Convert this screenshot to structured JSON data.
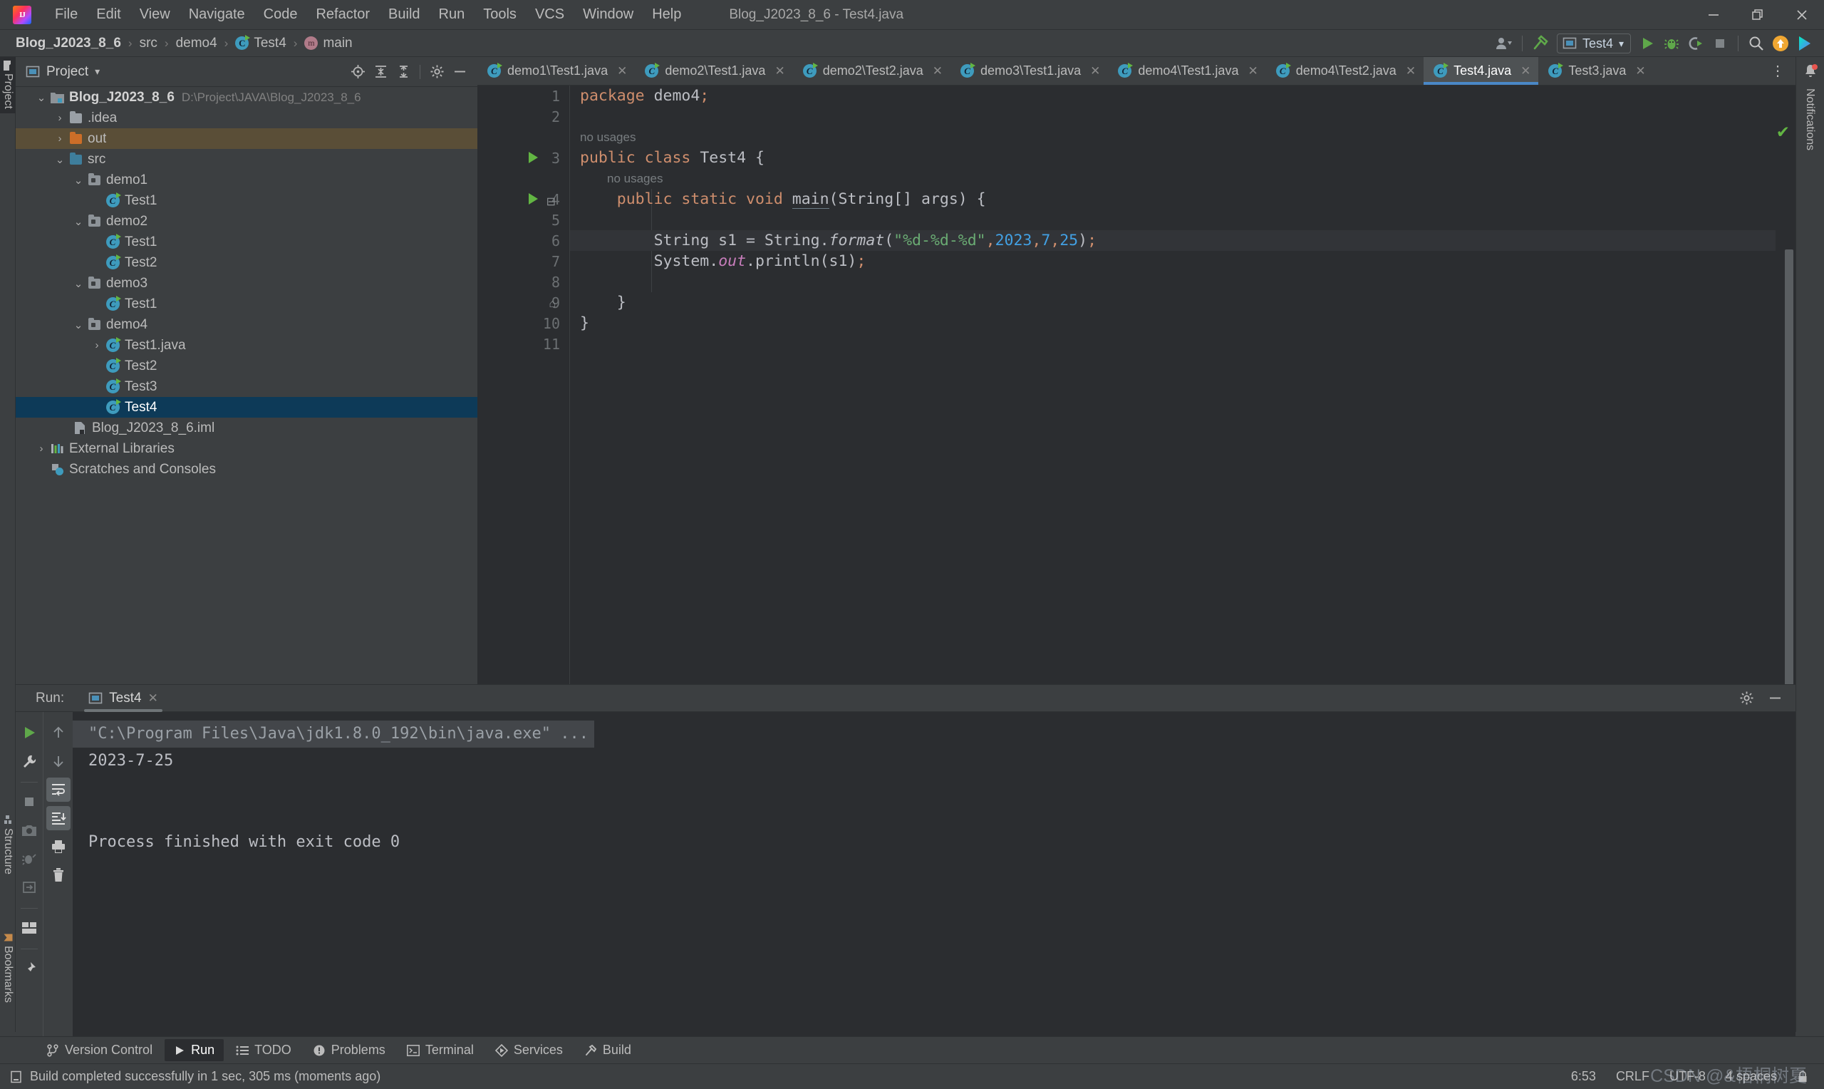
{
  "window": {
    "title": "Blog_J2023_8_6 - Test4.java",
    "minimize_label": "–",
    "restore_label": "❐",
    "close_label": "✕"
  },
  "menubar": {
    "items": [
      {
        "label": "File"
      },
      {
        "label": "Edit"
      },
      {
        "label": "View"
      },
      {
        "label": "Navigate"
      },
      {
        "label": "Code"
      },
      {
        "label": "Refactor"
      },
      {
        "label": "Build"
      },
      {
        "label": "Run"
      },
      {
        "label": "Tools"
      },
      {
        "label": "VCS"
      },
      {
        "label": "Window"
      },
      {
        "label": "Help"
      }
    ]
  },
  "navbar": {
    "crumbs": [
      {
        "label": "Blog_J2023_8_6",
        "icon": "project-icon"
      },
      {
        "label": "src",
        "icon": "none"
      },
      {
        "label": "demo4",
        "icon": "none"
      },
      {
        "label": "Test4",
        "icon": "java-class-icon"
      },
      {
        "label": "main",
        "icon": "method-icon"
      }
    ],
    "separator": "›",
    "run_config": "Test4",
    "run_config_caret": "▾",
    "icons": [
      "user-settings-icon",
      "build-hammer-icon",
      "run-icon",
      "debug-icon",
      "run-coverage-icon",
      "stop-icon",
      "search-everywhere-icon",
      "update-project-icon",
      "idea-assistant-icon"
    ]
  },
  "left_tool_strip": {
    "tabs": [
      {
        "label": "Project",
        "active": true
      },
      {
        "label": "Structure",
        "active": false
      },
      {
        "label": "Bookmarks",
        "active": false
      }
    ]
  },
  "right_tool_strip": {
    "label": "Notifications",
    "icon": "bell-icon",
    "has_badge": true
  },
  "project_panel": {
    "title": "Project",
    "title_caret": "▾",
    "toolbar_icons": [
      "locate-icon",
      "expand-all-icon",
      "collapse-all-icon",
      "settings-gear-icon",
      "hide-icon"
    ],
    "tree": [
      {
        "depth": 0,
        "arrow": "⌄",
        "icon": "project-module-icon",
        "label": "Blog_J2023_8_6",
        "sub": "D:\\Project\\JAVA\\Blog_J2023_8_6",
        "state": "bold"
      },
      {
        "depth": 1,
        "arrow": "›",
        "icon": "folder-grey-icon",
        "label": ".idea",
        "sub": "",
        "state": "normal"
      },
      {
        "depth": 1,
        "arrow": "›",
        "icon": "folder-orange-icon",
        "label": "out",
        "sub": "",
        "state": "highlight"
      },
      {
        "depth": 1,
        "arrow": "⌄",
        "icon": "folder-blue-icon",
        "label": "src",
        "sub": "",
        "state": "normal"
      },
      {
        "depth": 2,
        "arrow": "⌄",
        "icon": "package-icon",
        "label": "demo1",
        "sub": "",
        "state": "normal"
      },
      {
        "depth": 3,
        "arrow": "",
        "icon": "java-class-icon",
        "label": "Test1",
        "sub": "",
        "state": "normal"
      },
      {
        "depth": 2,
        "arrow": "⌄",
        "icon": "package-icon",
        "label": "demo2",
        "sub": "",
        "state": "normal"
      },
      {
        "depth": 3,
        "arrow": "",
        "icon": "java-class-icon",
        "label": "Test1",
        "sub": "",
        "state": "normal"
      },
      {
        "depth": 3,
        "arrow": "",
        "icon": "java-class-icon",
        "label": "Test2",
        "sub": "",
        "state": "normal"
      },
      {
        "depth": 2,
        "arrow": "⌄",
        "icon": "package-icon",
        "label": "demo3",
        "sub": "",
        "state": "normal"
      },
      {
        "depth": 3,
        "arrow": "",
        "icon": "java-class-icon",
        "label": "Test1",
        "sub": "",
        "state": "normal"
      },
      {
        "depth": 2,
        "arrow": "⌄",
        "icon": "package-icon",
        "label": "demo4",
        "sub": "",
        "state": "normal"
      },
      {
        "depth": 3,
        "arrow": "›",
        "icon": "java-class-icon",
        "label": "Test1.java",
        "sub": "",
        "state": "normal"
      },
      {
        "depth": 3,
        "arrow": "",
        "icon": "java-class-icon",
        "label": "Test2",
        "sub": "",
        "state": "normal"
      },
      {
        "depth": 3,
        "arrow": "",
        "icon": "java-class-icon",
        "label": "Test3",
        "sub": "",
        "state": "normal"
      },
      {
        "depth": 3,
        "arrow": "",
        "icon": "java-class-icon",
        "label": "Test4",
        "sub": "",
        "state": "selected"
      },
      {
        "depth": 2,
        "arrow": "",
        "icon": "iml-file-icon",
        "label": "Blog_J2023_8_6.iml",
        "sub": "",
        "state": "normal"
      },
      {
        "depth": 0,
        "arrow": "›",
        "icon": "external-libraries-icon",
        "label": "External Libraries",
        "sub": "",
        "state": "normal"
      },
      {
        "depth": 0,
        "arrow": "",
        "icon": "scratches-icon",
        "label": "Scratches and Consoles",
        "sub": "",
        "state": "normal"
      }
    ]
  },
  "editor": {
    "tabs": [
      {
        "label": "demo1\\Test1.java",
        "active": false
      },
      {
        "label": "demo2\\Test1.java",
        "active": false
      },
      {
        "label": "demo2\\Test2.java",
        "active": false
      },
      {
        "label": "demo3\\Test1.java",
        "active": false
      },
      {
        "label": "demo4\\Test1.java",
        "active": false
      },
      {
        "label": "demo4\\Test2.java",
        "active": false
      },
      {
        "label": "Test4.java",
        "active": true
      },
      {
        "label": "Test3.java",
        "active": false
      }
    ],
    "tab_close": "✕",
    "more_tabs": "⋮",
    "inspection_status": "✔",
    "line_numbers": [
      "1",
      "2",
      "3",
      "4",
      "5",
      "6",
      "7",
      "8",
      "9",
      "10",
      "11"
    ],
    "hints": [
      {
        "text": "no usages",
        "indent": 0
      },
      {
        "text": "no usages",
        "indent": 1
      }
    ],
    "code_lines": [
      "package demo4;",
      "",
      "public class Test4 {",
      "    public static void main(String[] args) {",
      "",
      "        String s1 = String.format(\"%d-%d-%d\",2023,7,25);",
      "        System.out.println(s1);",
      "",
      "    }",
      "}",
      ""
    ]
  },
  "run_panel": {
    "label": "Run:",
    "tab": "Test4",
    "tab_close": "✕",
    "tools": [
      "settings-gear-icon",
      "hide-icon"
    ],
    "sidebar_icons": [
      "rerun-icon",
      "wrench-icon",
      "stop-icon",
      "camera-icon",
      "dump-threads-icon",
      "export-icon",
      "layout-icon",
      "pin-icon"
    ],
    "sidebar2_icons": [
      "up-arrow-icon",
      "down-arrow-icon",
      "soft-wrap-icon",
      "scroll-to-end-icon",
      "print-icon",
      "trash-icon"
    ],
    "console_lines": [
      {
        "text": "\"C:\\Program Files\\Java\\jdk1.8.0_192\\bin\\java.exe\" ...",
        "type": "command"
      },
      {
        "text": "2023-7-25",
        "type": "output"
      },
      {
        "text": "",
        "type": "output"
      },
      {
        "text": "",
        "type": "output"
      },
      {
        "text": "Process finished with exit code 0",
        "type": "output"
      }
    ]
  },
  "bottom_bar": {
    "items": [
      {
        "label": "Version Control",
        "icon": "branch-icon",
        "active": false
      },
      {
        "label": "Run",
        "icon": "run-icon",
        "active": true
      },
      {
        "label": "TODO",
        "icon": "todo-icon",
        "active": false
      },
      {
        "label": "Problems",
        "icon": "problems-icon",
        "active": false
      },
      {
        "label": "Terminal",
        "icon": "terminal-icon",
        "active": false
      },
      {
        "label": "Services",
        "icon": "services-icon",
        "active": false
      },
      {
        "label": "Build",
        "icon": "build-hammer-icon",
        "active": false
      }
    ]
  },
  "status_bar": {
    "message": "Build completed successfully in 1 sec, 305 ms (moments ago)",
    "message_icon": "build-status-icon",
    "caret_position": "6:53",
    "line_separator": "CRLF",
    "encoding": "UTF-8",
    "indent": "4 spaces",
    "lock_icon": "lock-icon"
  },
  "watermark": {
    "text": "CSDN @&梧桐树夏"
  },
  "colors": {
    "accent": "#4a88c7",
    "selection": "#0d3a58",
    "run_green": "#62b543",
    "keyword": "#cf8e6d",
    "string": "#6aab73",
    "number": "#42a0e3",
    "editor_bg": "#2b2d30",
    "panel_bg": "#3c3f41"
  }
}
